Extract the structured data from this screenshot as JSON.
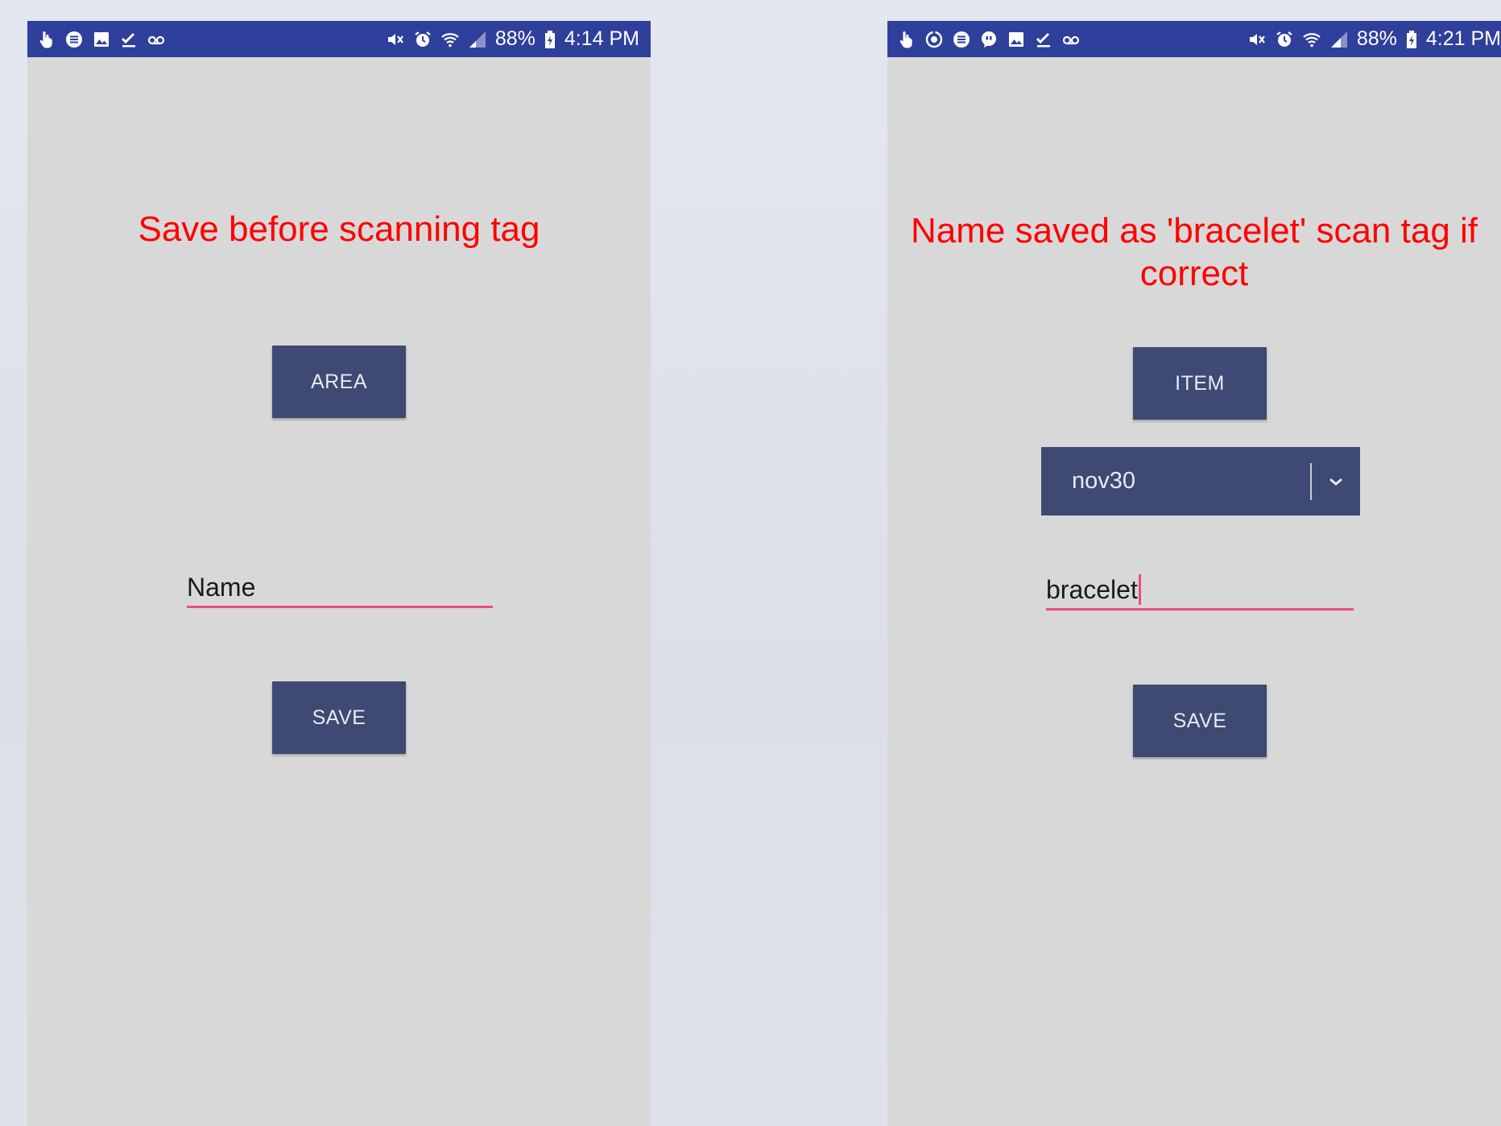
{
  "colors": {
    "status_bar": "#2f3f9c",
    "screen_background": "#d8d8d8",
    "button": "#3e4a73",
    "message": "#ff0000",
    "underline": "#ef4a82"
  },
  "screens": [
    {
      "status_bar": {
        "left_icons": [
          "touch-hand-icon",
          "message-icon",
          "image-icon",
          "checkmark-icon",
          "voicemail-icon"
        ],
        "right_icons": [
          "mute-icon",
          "alarm-icon",
          "wifi-icon",
          "signal-icon",
          "battery-charging-icon"
        ],
        "battery": "88%",
        "time": "4:14 PM"
      },
      "message": "Save before scanning tag",
      "top_button": "AREA",
      "name_field": {
        "value": "Name"
      },
      "save_button": "SAVE"
    },
    {
      "status_bar": {
        "left_icons": [
          "touch-hand-icon",
          "sync-icon",
          "message-icon",
          "chat-bubble-icon",
          "image-icon",
          "checkmark-icon",
          "voicemail-icon"
        ],
        "right_icons": [
          "mute-icon",
          "alarm-icon",
          "wifi-icon",
          "signal-icon",
          "battery-charging-icon"
        ],
        "battery": "88%",
        "time": "4:21 PM"
      },
      "message": "Name saved as 'bracelet' scan tag if correct",
      "top_button": "ITEM",
      "dropdown": {
        "selected": "nov30",
        "icon": "chevron-down-icon"
      },
      "name_field": {
        "value": "bracelet"
      },
      "save_button": "SAVE"
    }
  ]
}
